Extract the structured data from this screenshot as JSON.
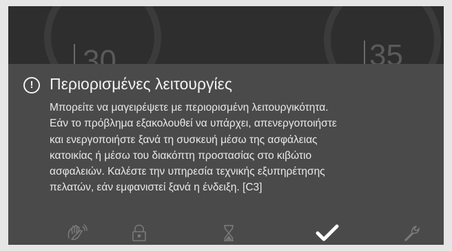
{
  "background": {
    "left_value": "30",
    "right_value": "35"
  },
  "dialog": {
    "icon": "exclamation-circle-icon",
    "icon_glyph": "!",
    "title": "Περιορισμένες λειτουργίες",
    "message_lines": [
      "Μπορείτε να μαγειρέψετε με περιορισμένη λειτουργικότητα.",
      "Εάν το πρόβλημα εξακολουθεί να υπάρχει, απενεργοποιήστε",
      "και ενεργοποιήστε ξανά τη συσκευή μέσω της ασφάλειας",
      "κατοικίας ή μέσω του διακόπτη προστασίας στο κιβώτιο",
      "ασφαλειών. Καλέστε την υπηρεσία τεχνικής εξυπηρέτησης",
      "πελατών, εάν εμφανιστεί ξανά η ένδειξη. [C3]"
    ]
  },
  "bottom_bar": {
    "items": [
      {
        "icon": "hand-wave-icon",
        "active": false
      },
      {
        "icon": "lock-icon",
        "active": false
      },
      {
        "icon": "hourglass-icon",
        "active": false
      },
      {
        "icon": "checkmark-icon",
        "active": true
      },
      {
        "icon": "wrench-icon",
        "active": false
      }
    ]
  },
  "colors": {
    "overlay_bg": "#4a4a4a",
    "screen_bg": "#2e2e2e",
    "text": "#f2f2f2",
    "icon_dim": "#7a7a7a",
    "icon_active": "#ffffff"
  }
}
